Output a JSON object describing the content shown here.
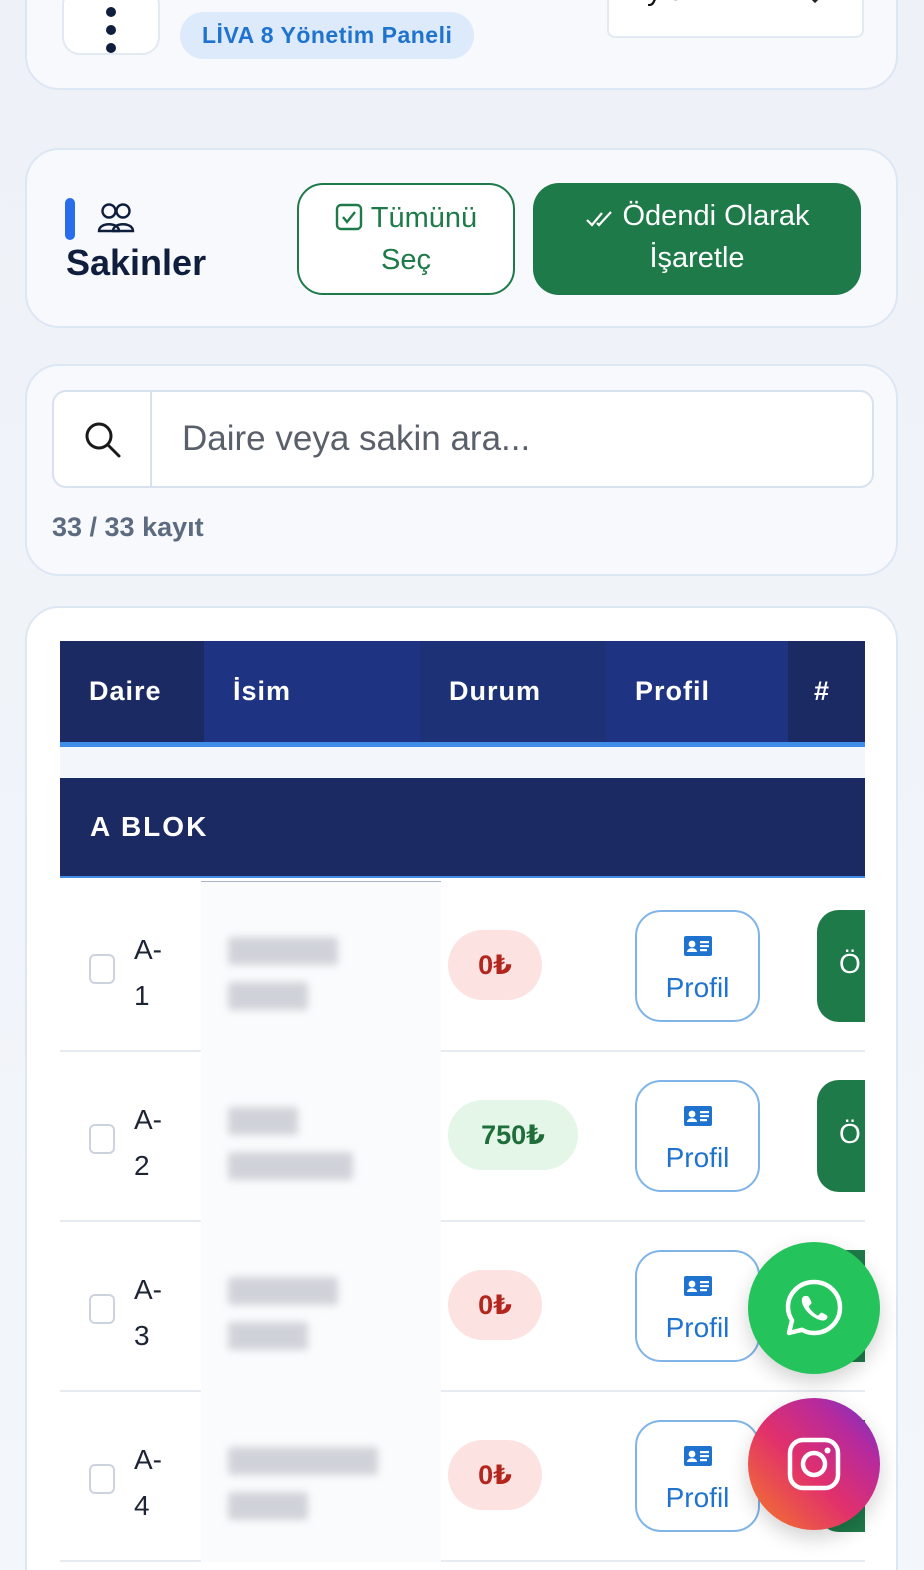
{
  "header": {
    "panel_badge": "LİVA 8 Yönetim Paneli",
    "month_select": {
      "selected": "Eylül"
    }
  },
  "residents": {
    "title": "Sakinler",
    "select_all_line1": "Tümünü",
    "select_all_line2": "Seç",
    "mark_paid_line1": "Ödendi Olarak",
    "mark_paid_line2": "İşaretle"
  },
  "search": {
    "placeholder": "Daire veya sakin ara...",
    "record_count": "33 / 33 kayıt"
  },
  "table": {
    "columns": [
      "Daire",
      "İsim",
      "Durum",
      "Profil",
      "#"
    ],
    "block_title": "A BLOK",
    "rows": [
      {
        "unit_line1": "A-",
        "unit_line2": "1",
        "amount": "0₺",
        "status": "unpaid",
        "profile": "Profil",
        "paid": "Ö"
      },
      {
        "unit_line1": "A-",
        "unit_line2": "2",
        "amount": "750₺",
        "status": "paid",
        "profile": "Profil",
        "paid": "Ö"
      },
      {
        "unit_line1": "A-",
        "unit_line2": "3",
        "amount": "0₺",
        "status": "unpaid",
        "profile": "Profil",
        "paid": ""
      },
      {
        "unit_line1": "A-",
        "unit_line2": "4",
        "amount": "0₺",
        "status": "unpaid",
        "profile": "Profil",
        "paid": ""
      }
    ]
  },
  "colors": {
    "primary_green": "#1f7a49",
    "navy_header": "#1b2a63",
    "accent_blue": "#2a6dea",
    "unpaid_red": "#b3261e",
    "paid_green": "#1f6e3a"
  },
  "icons": {
    "menu": "more-vertical-icon",
    "month_chevron": "chevron-down-icon",
    "users": "users-icon",
    "checkbox": "check-square-icon",
    "double_check": "double-check-icon",
    "search": "search-icon",
    "profile": "id-card-icon",
    "whatsapp": "whatsapp-icon",
    "instagram": "instagram-icon"
  }
}
